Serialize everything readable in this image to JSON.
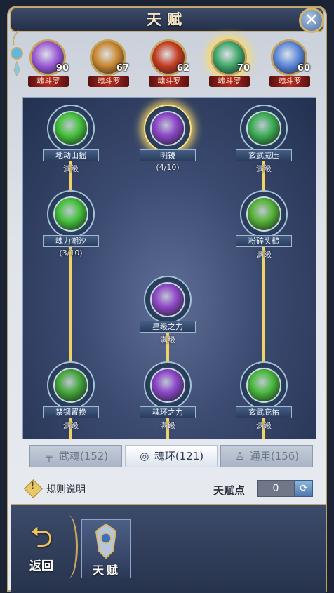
{
  "window": {
    "title": "天赋"
  },
  "characters": [
    {
      "tag": "魂斗罗",
      "level": "90",
      "color": "#9b5ad6",
      "selected": false
    },
    {
      "tag": "魂斗罗",
      "level": "67",
      "color": "#c8862e",
      "selected": false
    },
    {
      "tag": "魂斗罗",
      "level": "62",
      "color": "#c43b1f",
      "selected": false
    },
    {
      "tag": "魂斗罗",
      "level": "70",
      "color": "#3fa66a",
      "selected": true
    },
    {
      "tag": "魂斗罗",
      "level": "60",
      "color": "#5a86d9",
      "selected": false
    }
  ],
  "talents": [
    {
      "name": "地动山摇",
      "progress": "满级",
      "color": "#47c23e"
    },
    {
      "name": "明镜",
      "progress": "(4/10)",
      "color": "#8e47c9",
      "active": true
    },
    {
      "name": "玄武威压",
      "progress": "满级",
      "color": "#3fae57"
    },
    {
      "name": "魂力潮汐",
      "progress": "(3/10)",
      "color": "#47c23e"
    },
    {
      "name": "粉碎头槌",
      "progress": "满级",
      "color": "#59b43b"
    },
    {
      "name": "星级之力",
      "progress": "满级",
      "color": "#9149c9"
    },
    {
      "name": "禁锢置换",
      "progress": "满级",
      "color": "#47a83e"
    },
    {
      "name": "魂环之力",
      "progress": "满级",
      "color": "#8e47c9"
    },
    {
      "name": "玄武庇佑",
      "progress": "满级",
      "color": "#4cba3e"
    }
  ],
  "tabs": [
    {
      "label": "武魂(152)",
      "icon": "╤",
      "selected": false
    },
    {
      "label": "魂环(121)",
      "icon": "◎",
      "selected": true
    },
    {
      "label": "通用(156)",
      "icon": "♙",
      "selected": false
    }
  ],
  "rules": {
    "label": "规则说明"
  },
  "talent_points": {
    "label": "天赋点",
    "value": "0"
  },
  "bottom": {
    "back_label": "返回",
    "talent_label": "天赋"
  },
  "colors": {
    "gold": "#c9ad6c",
    "link": "#f1d264"
  }
}
